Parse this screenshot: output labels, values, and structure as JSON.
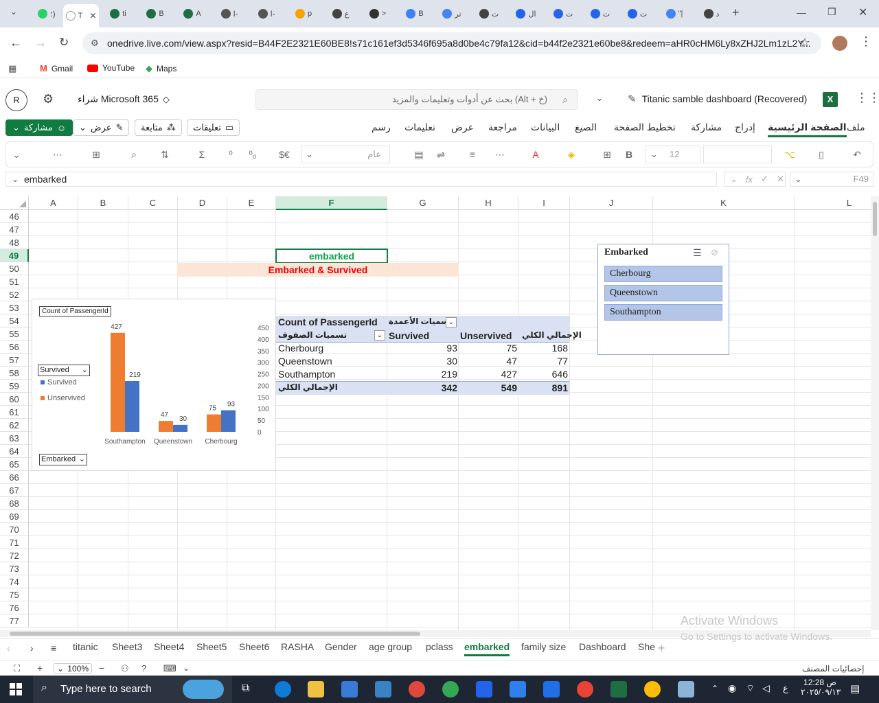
{
  "browser": {
    "tabs": [
      {
        "label": "؛)",
        "color": "#25d366"
      },
      {
        "label": "T",
        "color": "#ffffff",
        "active": true
      },
      {
        "label": "ti",
        "color": "#1d6f42"
      },
      {
        "label": "B",
        "color": "#1d6f42"
      },
      {
        "label": "A",
        "color": "#1d6f42"
      },
      {
        "label": "ا-",
        "color": "#555"
      },
      {
        "label": "ا-",
        "color": "#555"
      },
      {
        "label": "p",
        "color": "#f4a300"
      },
      {
        "label": "ع",
        "color": "#444"
      },
      {
        "label": ">",
        "color": "#333"
      },
      {
        "label": "B",
        "color": "#3b82f6"
      },
      {
        "label": "تر",
        "color": "#4285f4"
      },
      {
        "label": "ت",
        "color": "#444"
      },
      {
        "label": "ال",
        "color": "#2563eb"
      },
      {
        "label": "ت",
        "color": "#2563eb"
      },
      {
        "label": "ت",
        "color": "#2563eb"
      },
      {
        "label": "ت",
        "color": "#2563eb"
      },
      {
        "label": "\"|",
        "color": "#4285f4"
      },
      {
        "label": "د",
        "color": "#444"
      }
    ],
    "active_tab_close": "✕",
    "new_tab": "+",
    "url": "onedrive.live.com/view.aspx?resid=B44F2E2321E60BE8!s71c161ef3d5346f695a8d0be4c79fa12&cid=b44f2e2321e60be8&redeem=aHR0cHM6Ly8xZHJ2Lm1zL2Y...",
    "bookmarks": [
      "Gmail",
      "YouTube",
      "Maps"
    ]
  },
  "excel": {
    "user_initial": "R",
    "buy_label": "شراء Microsoft 365",
    "search_placeholder": "بحث عن أدوات وتعليمات والمزيد (Alt + خ)",
    "doc_title": "Titanic samble dashboard (Recovered)",
    "share_label": "مشاركة",
    "view_label": "عرض",
    "follow_label": "متابعة",
    "comments_label": "تعليقات",
    "menu": [
      "ملف",
      "الصفحة الرئيسية",
      "إدراج",
      "مشاركة",
      "تخطيط الصفحة",
      "الصيغ",
      "البيانات",
      "مراجعة",
      "عرض",
      "تعليمات",
      "رسم"
    ],
    "font_size": "12",
    "number_format": "عام",
    "name_box": "F49",
    "formula_value": "embarked"
  },
  "grid": {
    "columns": [
      "A",
      "B",
      "C",
      "D",
      "E",
      "F",
      "G",
      "H",
      "I",
      "J",
      "K",
      "L"
    ],
    "rows": [
      "46",
      "47",
      "48",
      "49",
      "50",
      "51",
      "52",
      "53",
      "54",
      "55",
      "56",
      "57",
      "58",
      "59",
      "60",
      "61",
      "62",
      "63",
      "64",
      "65",
      "66",
      "67",
      "68",
      "69",
      "70",
      "71",
      "72",
      "73",
      "74",
      "75",
      "76",
      "77"
    ],
    "selected_column": "F",
    "selected_row": "49",
    "cell_f49": "embarked",
    "title_row50": "Embarked & Survived"
  },
  "pivot": {
    "value_label": "Count of PassengerId",
    "col_labels": "تسميات الأعمدة",
    "row_labels": "تسميات الصفوف",
    "headers": [
      "Survived",
      "Unservived",
      "الإجمالي الكلي"
    ],
    "rows": [
      {
        "label": "Cherbourg",
        "values": [
          "93",
          "75",
          "168"
        ]
      },
      {
        "label": "Queenstown",
        "values": [
          "30",
          "47",
          "77"
        ]
      },
      {
        "label": "Southampton",
        "values": [
          "219",
          "427",
          "646"
        ]
      }
    ],
    "total": {
      "label": "الإجمالي الكلي",
      "values": [
        "342",
        "549",
        "891"
      ]
    }
  },
  "chart_data": {
    "type": "bar",
    "title": "",
    "field_button": "Count of PassengerId",
    "legend_field": "Survived",
    "axis_field": "Embarked",
    "categories": [
      "Southampton",
      "Queenstown",
      "Cherbourg"
    ],
    "series": [
      {
        "name": "Survived",
        "color": "#4472c4",
        "values": [
          219,
          30,
          93
        ]
      },
      {
        "name": "Unservived",
        "color": "#ed7d31",
        "values": [
          427,
          47,
          75
        ]
      }
    ],
    "ylim": [
      0,
      450
    ],
    "yticks": [
      "450",
      "400",
      "350",
      "300",
      "250",
      "200",
      "150",
      "100",
      "50",
      "0"
    ],
    "legend": "left"
  },
  "slicer": {
    "title": "Embarked",
    "items": [
      "Cherbourg",
      "Queenstown",
      "Southampton"
    ]
  },
  "sheets": {
    "tabs": [
      "titanic",
      "Sheet3",
      "Sheet4",
      "Sheet5",
      "Sheet6",
      "RASHA",
      "Gender",
      "age group",
      "pclass",
      "embarked",
      "family size",
      "Dashboard",
      "She"
    ],
    "active": "embarked"
  },
  "status": {
    "zoom": "100%",
    "workbook_stats": "إحصائيات المصنف"
  },
  "watermark": {
    "line1": "Activate Windows",
    "line2": "Go to Settings to activate Windows."
  },
  "taskbar": {
    "search_placeholder": "Type here to search",
    "time": "12:28 ص",
    "date": "٢٠٢٥/٠٩/١٣",
    "lang": "ع"
  }
}
